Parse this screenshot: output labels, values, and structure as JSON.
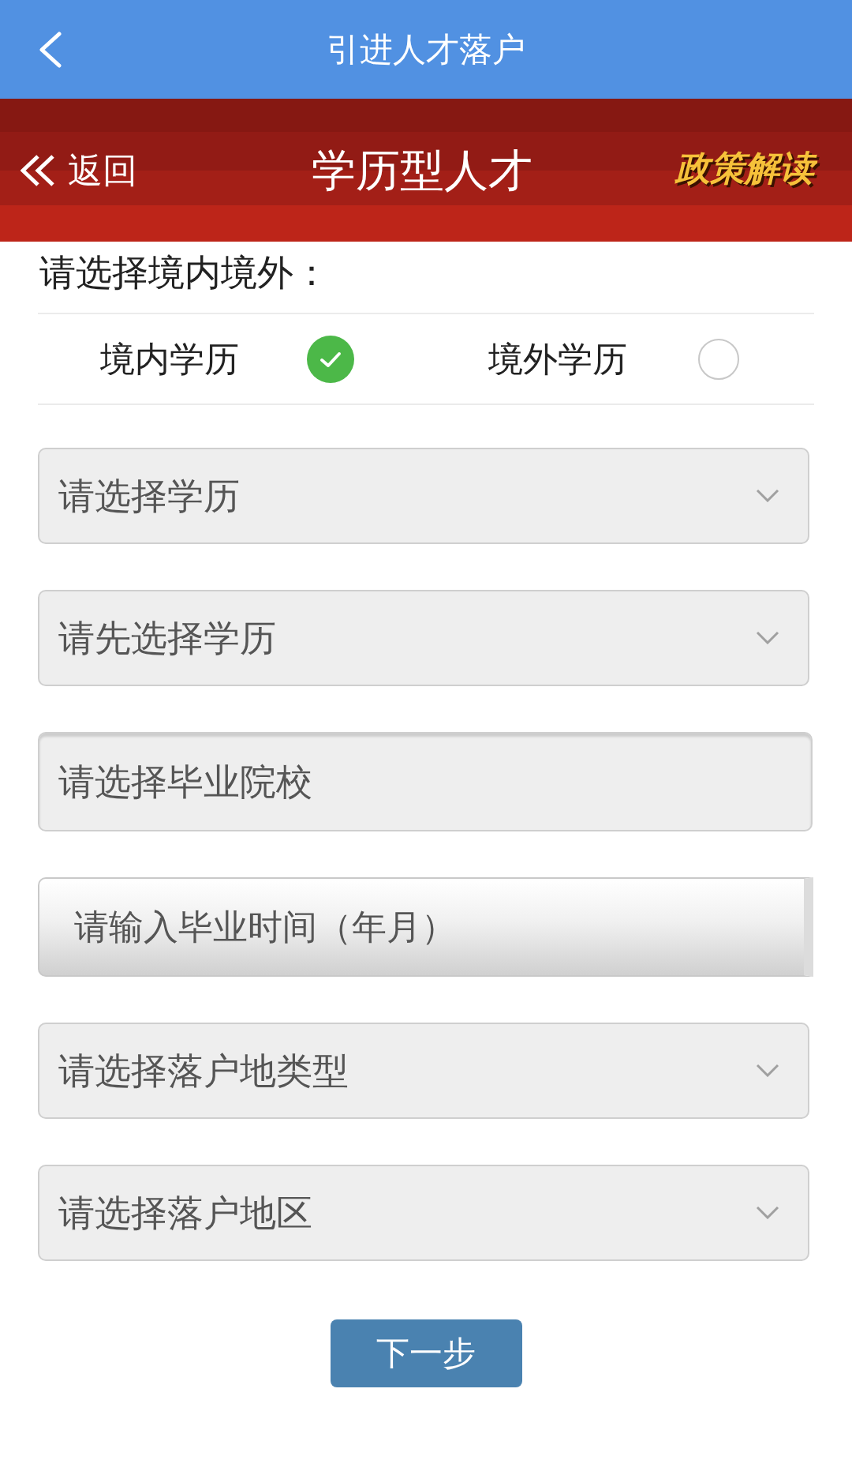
{
  "top_bar": {
    "title": "引进人才落户"
  },
  "banner": {
    "back_label": "返回",
    "title": "学历型人才",
    "policy_link": "政策解读"
  },
  "region_prompt": "请选择境内境外：",
  "region_options": [
    {
      "label": "境内学历",
      "selected": true
    },
    {
      "label": "境外学历",
      "selected": false
    }
  ],
  "fields": [
    {
      "kind": "select",
      "placeholder": "请选择学历"
    },
    {
      "kind": "select",
      "placeholder": "请先选择学历"
    },
    {
      "kind": "text",
      "placeholder": "请选择毕业院校"
    },
    {
      "kind": "date",
      "placeholder": "请输入毕业时间（年月）"
    },
    {
      "kind": "select",
      "placeholder": "请选择落户地类型"
    },
    {
      "kind": "select",
      "placeholder": "请选择落户地区"
    }
  ],
  "next_button": "下一步"
}
